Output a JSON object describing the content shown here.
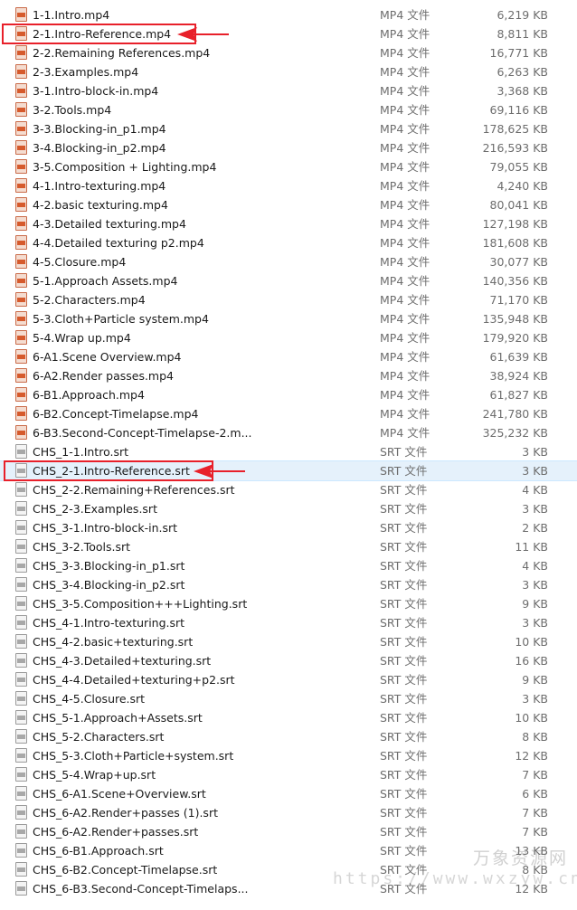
{
  "files": [
    {
      "name": "1-1.Intro.mp4",
      "type": "MP4 文件",
      "size": "6,219 KB",
      "icon": "video-file-icon"
    },
    {
      "name": "2-1.Intro-Reference.mp4",
      "type": "MP4 文件",
      "size": "8,811 KB",
      "icon": "video-file-icon"
    },
    {
      "name": "2-2.Remaining References.mp4",
      "type": "MP4 文件",
      "size": "16,771 KB",
      "icon": "video-file-icon"
    },
    {
      "name": "2-3.Examples.mp4",
      "type": "MP4 文件",
      "size": "6,263 KB",
      "icon": "video-file-icon"
    },
    {
      "name": "3-1.Intro-block-in.mp4",
      "type": "MP4 文件",
      "size": "3,368 KB",
      "icon": "video-file-icon"
    },
    {
      "name": "3-2.Tools.mp4",
      "type": "MP4 文件",
      "size": "69,116 KB",
      "icon": "video-file-icon"
    },
    {
      "name": "3-3.Blocking-in_p1.mp4",
      "type": "MP4 文件",
      "size": "178,625 KB",
      "icon": "video-file-icon"
    },
    {
      "name": "3-4.Blocking-in_p2.mp4",
      "type": "MP4 文件",
      "size": "216,593 KB",
      "icon": "video-file-icon"
    },
    {
      "name": "3-5.Composition + Lighting.mp4",
      "type": "MP4 文件",
      "size": "79,055 KB",
      "icon": "video-file-icon"
    },
    {
      "name": "4-1.Intro-texturing.mp4",
      "type": "MP4 文件",
      "size": "4,240 KB",
      "icon": "video-file-icon"
    },
    {
      "name": "4-2.basic texturing.mp4",
      "type": "MP4 文件",
      "size": "80,041 KB",
      "icon": "video-file-icon"
    },
    {
      "name": "4-3.Detailed texturing.mp4",
      "type": "MP4 文件",
      "size": "127,198 KB",
      "icon": "video-file-icon"
    },
    {
      "name": "4-4.Detailed texturing p2.mp4",
      "type": "MP4 文件",
      "size": "181,608 KB",
      "icon": "video-file-icon"
    },
    {
      "name": "4-5.Closure.mp4",
      "type": "MP4 文件",
      "size": "30,077 KB",
      "icon": "video-file-icon"
    },
    {
      "name": "5-1.Approach Assets.mp4",
      "type": "MP4 文件",
      "size": "140,356 KB",
      "icon": "video-file-icon"
    },
    {
      "name": "5-2.Characters.mp4",
      "type": "MP4 文件",
      "size": "71,170 KB",
      "icon": "video-file-icon"
    },
    {
      "name": "5-3.Cloth+Particle system.mp4",
      "type": "MP4 文件",
      "size": "135,948 KB",
      "icon": "video-file-icon"
    },
    {
      "name": "5-4.Wrap up.mp4",
      "type": "MP4 文件",
      "size": "179,920 KB",
      "icon": "video-file-icon"
    },
    {
      "name": "6-A1.Scene Overview.mp4",
      "type": "MP4 文件",
      "size": "61,639 KB",
      "icon": "video-file-icon"
    },
    {
      "name": "6-A2.Render passes.mp4",
      "type": "MP4 文件",
      "size": "38,924 KB",
      "icon": "video-file-icon"
    },
    {
      "name": "6-B1.Approach.mp4",
      "type": "MP4 文件",
      "size": "61,827 KB",
      "icon": "video-file-icon"
    },
    {
      "name": "6-B2.Concept-Timelapse.mp4",
      "type": "MP4 文件",
      "size": "241,780 KB",
      "icon": "video-file-icon"
    },
    {
      "name": "6-B3.Second-Concept-Timelapse-2.m...",
      "type": "MP4 文件",
      "size": "325,232 KB",
      "icon": "video-file-icon"
    },
    {
      "name": "CHS_1-1.Intro.srt",
      "type": "SRT 文件",
      "size": "3 KB",
      "icon": "subtitle-file-icon"
    },
    {
      "name": "CHS_2-1.Intro-Reference.srt",
      "type": "SRT 文件",
      "size": "3 KB",
      "icon": "subtitle-file-icon"
    },
    {
      "name": "CHS_2-2.Remaining+References.srt",
      "type": "SRT 文件",
      "size": "4 KB",
      "icon": "subtitle-file-icon"
    },
    {
      "name": "CHS_2-3.Examples.srt",
      "type": "SRT 文件",
      "size": "3 KB",
      "icon": "subtitle-file-icon"
    },
    {
      "name": "CHS_3-1.Intro-block-in.srt",
      "type": "SRT 文件",
      "size": "2 KB",
      "icon": "subtitle-file-icon"
    },
    {
      "name": "CHS_3-2.Tools.srt",
      "type": "SRT 文件",
      "size": "11 KB",
      "icon": "subtitle-file-icon"
    },
    {
      "name": "CHS_3-3.Blocking-in_p1.srt",
      "type": "SRT 文件",
      "size": "4 KB",
      "icon": "subtitle-file-icon"
    },
    {
      "name": "CHS_3-4.Blocking-in_p2.srt",
      "type": "SRT 文件",
      "size": "3 KB",
      "icon": "subtitle-file-icon"
    },
    {
      "name": "CHS_3-5.Composition+++Lighting.srt",
      "type": "SRT 文件",
      "size": "9 KB",
      "icon": "subtitle-file-icon"
    },
    {
      "name": "CHS_4-1.Intro-texturing.srt",
      "type": "SRT 文件",
      "size": "3 KB",
      "icon": "subtitle-file-icon"
    },
    {
      "name": "CHS_4-2.basic+texturing.srt",
      "type": "SRT 文件",
      "size": "10 KB",
      "icon": "subtitle-file-icon"
    },
    {
      "name": "CHS_4-3.Detailed+texturing.srt",
      "type": "SRT 文件",
      "size": "16 KB",
      "icon": "subtitle-file-icon"
    },
    {
      "name": "CHS_4-4.Detailed+texturing+p2.srt",
      "type": "SRT 文件",
      "size": "9 KB",
      "icon": "subtitle-file-icon"
    },
    {
      "name": "CHS_4-5.Closure.srt",
      "type": "SRT 文件",
      "size": "3 KB",
      "icon": "subtitle-file-icon"
    },
    {
      "name": "CHS_5-1.Approach+Assets.srt",
      "type": "SRT 文件",
      "size": "10 KB",
      "icon": "subtitle-file-icon"
    },
    {
      "name": "CHS_5-2.Characters.srt",
      "type": "SRT 文件",
      "size": "8 KB",
      "icon": "subtitle-file-icon"
    },
    {
      "name": "CHS_5-3.Cloth+Particle+system.srt",
      "type": "SRT 文件",
      "size": "12 KB",
      "icon": "subtitle-file-icon"
    },
    {
      "name": "CHS_5-4.Wrap+up.srt",
      "type": "SRT 文件",
      "size": "7 KB",
      "icon": "subtitle-file-icon"
    },
    {
      "name": "CHS_6-A1.Scene+Overview.srt",
      "type": "SRT 文件",
      "size": "6 KB",
      "icon": "subtitle-file-icon"
    },
    {
      "name": "CHS_6-A2.Render+passes (1).srt",
      "type": "SRT 文件",
      "size": "7 KB",
      "icon": "subtitle-file-icon"
    },
    {
      "name": "CHS_6-A2.Render+passes.srt",
      "type": "SRT 文件",
      "size": "7 KB",
      "icon": "subtitle-file-icon"
    },
    {
      "name": "CHS_6-B1.Approach.srt",
      "type": "SRT 文件",
      "size": "13 KB",
      "icon": "subtitle-file-icon"
    },
    {
      "name": "CHS_6-B2.Concept-Timelapse.srt",
      "type": "SRT 文件",
      "size": "8 KB",
      "icon": "subtitle-file-icon"
    },
    {
      "name": "CHS_6-B3.Second-Concept-Timelaps...",
      "type": "SRT 文件",
      "size": "12 KB",
      "icon": "subtitle-file-icon"
    }
  ],
  "selected_file": "CHS_2-1.Intro-Reference.srt",
  "highlighted_files": [
    "2-1.Intro-Reference.mp4",
    "CHS_2-1.Intro-Reference.srt"
  ],
  "colors": {
    "highlight": "#e8202a",
    "selection": "#e5f1fb",
    "mp4_icon": "#d65a2c",
    "srt_icon": "#a8a8a8"
  },
  "watermark": {
    "brand": "万象资源网",
    "url": "https://www.wxzyw.cn"
  }
}
